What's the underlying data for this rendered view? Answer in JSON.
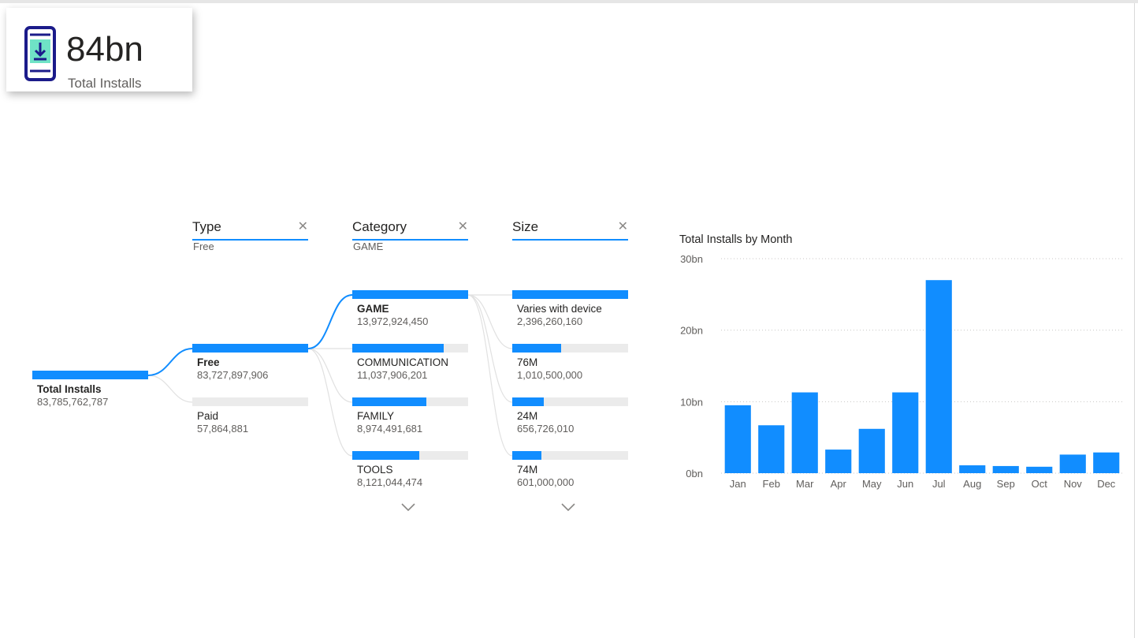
{
  "kpi": {
    "value": "84bn",
    "label": "Total Installs",
    "icon": "mobile-download-icon"
  },
  "tree": {
    "root": {
      "label": "Total Installs",
      "value": "83,785,762,787",
      "fill": 1.0
    },
    "levels": [
      {
        "title": "Type",
        "filter": "Free",
        "nodes": [
          {
            "label": "Free",
            "value": "83,727,897,906",
            "fill": 1.0,
            "selected": true
          },
          {
            "label": "Paid",
            "value": "57,864,881",
            "fill": 0.0007,
            "selected": false
          }
        ],
        "more": false
      },
      {
        "title": "Category",
        "filter": "GAME",
        "nodes": [
          {
            "label": "GAME",
            "value": "13,972,924,450",
            "fill": 1.0,
            "selected": true
          },
          {
            "label": "COMMUNICATION",
            "value": "11,037,906,201",
            "fill": 0.79,
            "selected": false
          },
          {
            "label": "FAMILY",
            "value": "8,974,491,681",
            "fill": 0.64,
            "selected": false
          },
          {
            "label": "TOOLS",
            "value": "8,121,044,474",
            "fill": 0.58,
            "selected": false
          }
        ],
        "more": true
      },
      {
        "title": "Size",
        "filter": "",
        "nodes": [
          {
            "label": "Varies with device",
            "value": "2,396,260,160",
            "fill": 1.0,
            "selected": false
          },
          {
            "label": "76M",
            "value": "1,010,500,000",
            "fill": 0.42,
            "selected": false
          },
          {
            "label": "24M",
            "value": "656,726,010",
            "fill": 0.27,
            "selected": false
          },
          {
            "label": "74M",
            "value": "601,000,000",
            "fill": 0.25,
            "selected": false
          }
        ],
        "more": true
      }
    ],
    "close_icon": "close-icon",
    "more_icon": "chevron-down-icon"
  },
  "chart": {
    "title": "Total Installs by Month"
  },
  "chart_data": {
    "type": "bar",
    "title": "Total Installs by Month",
    "xlabel": "",
    "ylabel": "",
    "categories": [
      "Jan",
      "Feb",
      "Mar",
      "Apr",
      "May",
      "Jun",
      "Jul",
      "Aug",
      "Sep",
      "Oct",
      "Nov",
      "Dec"
    ],
    "values": [
      9.5,
      6.7,
      11.3,
      3.3,
      6.2,
      11.3,
      27.0,
      1.1,
      1.0,
      0.9,
      2.6,
      2.9
    ],
    "unit": "bn",
    "ylim": [
      0,
      30
    ],
    "yticks": [
      "0bn",
      "10bn",
      "20bn",
      "30bn"
    ],
    "color": "#118DFF",
    "grid": true
  },
  "colors": {
    "accent": "#118DFF",
    "track": "#ebebeb",
    "text": "#252423",
    "subtext": "#605e5c"
  }
}
